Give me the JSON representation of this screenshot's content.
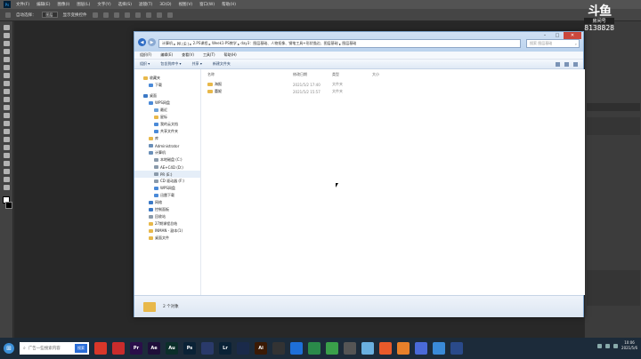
{
  "ps": {
    "menu": [
      "文件(F)",
      "编辑(E)",
      "图像(I)",
      "图层(L)",
      "文字(Y)",
      "选择(S)",
      "滤镜(T)",
      "3D(D)",
      "视图(V)",
      "窗口(W)",
      "帮助(H)"
    ],
    "options": {
      "auto_select": "自动选择：",
      "layer_select": "图层",
      "show_transform": "显示变换控件"
    }
  },
  "watermark": {
    "logo": "斗鱼",
    "sub": "房间号",
    "room": "8138828"
  },
  "explorer": {
    "address": [
      "计算机",
      "PR (E:)",
      "2.PS课程",
      "Week1-PS教学",
      "day3：图层基础、人物抠像、钢笔工具+形状描边、图层基础",
      "图层基础"
    ],
    "search_placeholder": "搜索 图层基础",
    "menu": [
      "组织(F)",
      "编辑(E)",
      "查看(V)",
      "工具(T)",
      "帮助(H)"
    ],
    "commands": [
      "组织 ▾",
      "包含到库中 ▾",
      "共享 ▾",
      "新建文件夹"
    ],
    "nav": [
      {
        "label": "收藏夹",
        "color": "#e8b84a"
      },
      {
        "label": "下载",
        "color": "#4a8ad8"
      },
      {
        "label": "",
        "color": ""
      },
      {
        "label": "桌面",
        "color": "#3b79c6"
      },
      {
        "label": "WPS网盘",
        "color": "#4a8ad8"
      },
      {
        "label": "最近",
        "color": "#6aa0d8"
      },
      {
        "label": "星标",
        "color": "#e8b84a"
      },
      {
        "label": "我的云文档",
        "color": "#4a8ad8"
      },
      {
        "label": "共享文件夹",
        "color": "#4a8ad8"
      },
      {
        "label": "库",
        "color": "#e8b84a"
      },
      {
        "label": "Administrator",
        "color": "#6a8fb8"
      },
      {
        "label": "计算机",
        "color": "#6a8fb8"
      },
      {
        "label": "本地磁盘 (C:)",
        "color": "#8a9aaa"
      },
      {
        "label": "AE+C4D (D:)",
        "color": "#8a9aaa"
      },
      {
        "label": "PR (E:)",
        "color": "#8a9aaa"
      },
      {
        "label": "CD 驱动器 (F:)",
        "color": "#8a9aaa"
      },
      {
        "label": "WPS网盘",
        "color": "#4a8ad8"
      },
      {
        "label": "迅雷下载",
        "color": "#4a8ad8"
      },
      {
        "label": "网络",
        "color": "#3b79c6"
      },
      {
        "label": "控制面板",
        "color": "#3b79c6"
      },
      {
        "label": "回收站",
        "color": "#8a9aaa"
      },
      {
        "label": "27期课程总结",
        "color": "#e8b84a"
      },
      {
        "label": "INMAN - 副本(1)",
        "color": "#e8b84a"
      },
      {
        "label": "桌面文件",
        "color": "#e8b84a"
      }
    ],
    "columns": {
      "name": "名称",
      "date": "修改日期",
      "type": "类型",
      "size": "大小"
    },
    "rows": [
      {
        "name": "海报",
        "date": "2021/5/2 17:40",
        "type": "文件夹"
      },
      {
        "name": "蕾妮",
        "date": "2021/5/2 15:57",
        "type": "文件夹"
      }
    ],
    "status": "2 个对象"
  },
  "taskbar": {
    "search_placeholder": "广告一些搜索内容",
    "search_btn": "搜索",
    "apps": [
      {
        "label": "",
        "color": "#d8372a"
      },
      {
        "label": "",
        "color": "#c92c2c"
      },
      {
        "label": "Pr",
        "color": "#2a0f4a"
      },
      {
        "label": "Ae",
        "color": "#1f0f3a"
      },
      {
        "label": "Au",
        "color": "#0b2f2a"
      },
      {
        "label": "Ps",
        "color": "#0a2236"
      },
      {
        "label": "",
        "color": "#2a3a6a"
      },
      {
        "label": "Lr",
        "color": "#0a2236"
      },
      {
        "label": "",
        "color": "#1a2a4a"
      },
      {
        "label": "Ai",
        "color": "#3a1a05"
      },
      {
        "label": "",
        "color": "#333"
      },
      {
        "label": "",
        "color": "#1e6fd8"
      },
      {
        "label": "",
        "color": "#2a8a4a"
      },
      {
        "label": "",
        "color": "#3aa04a"
      },
      {
        "label": "",
        "color": "#555"
      },
      {
        "label": "",
        "color": "#6ab0e0"
      },
      {
        "label": "",
        "color": "#e85a2a"
      },
      {
        "label": "",
        "color": "#e8802a"
      },
      {
        "label": "",
        "color": "#4a6ad8"
      },
      {
        "label": "",
        "color": "#3a8ad8"
      },
      {
        "label": "",
        "color": "#2a4a8a"
      }
    ],
    "time": "10:06",
    "date": "2021/5/6"
  }
}
